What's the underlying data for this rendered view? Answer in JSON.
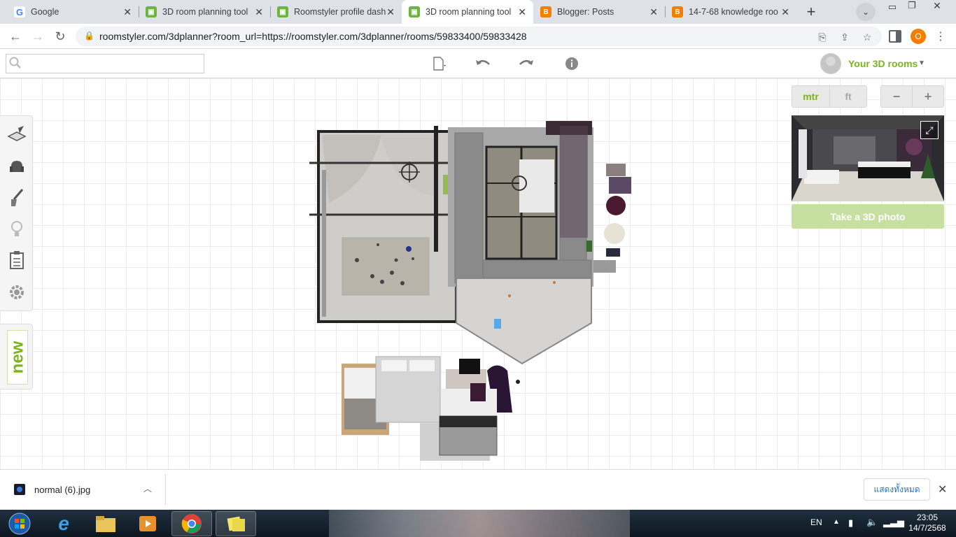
{
  "browser": {
    "tabs": [
      {
        "title": "Google",
        "favicon": "google-icon",
        "color": "#4285f4"
      },
      {
        "title": "3D room planning tool",
        "favicon": "roomstyler-icon",
        "color": "#6bb43f"
      },
      {
        "title": "Roomstyler profile dash",
        "favicon": "roomstyler-icon",
        "color": "#6bb43f"
      },
      {
        "title": "3D room planning tool",
        "favicon": "roomstyler-icon",
        "color": "#6bb43f"
      },
      {
        "title": "Blogger: Posts",
        "favicon": "blogger-icon",
        "color": "#f57d00"
      },
      {
        "title": "14-7-68 knowledge roo",
        "favicon": "blogger-icon",
        "color": "#f57d00"
      }
    ],
    "active_tab": 3,
    "url": "roomstyler.com/3dplanner?room_url=https://roomstyler.com/3dplanner/rooms/59833400/59833428",
    "profile_initial": "O"
  },
  "app": {
    "search": {
      "value": "",
      "placeholder": ""
    },
    "user_menu_label": "Your 3D rooms",
    "units": {
      "metric": "mtr",
      "imperial": "ft",
      "selected": "mtr"
    },
    "zoom_out": "−",
    "zoom_in": "+",
    "photo_button": "Take a 3D photo",
    "new_label": "new",
    "accent_color": "#7ab51d"
  },
  "download": {
    "file_name": "normal (6).jpg",
    "show_all": "แสดงทั้งหมด"
  },
  "taskbar": {
    "language": "EN",
    "time": "23:05",
    "date": "14/7/2568"
  }
}
